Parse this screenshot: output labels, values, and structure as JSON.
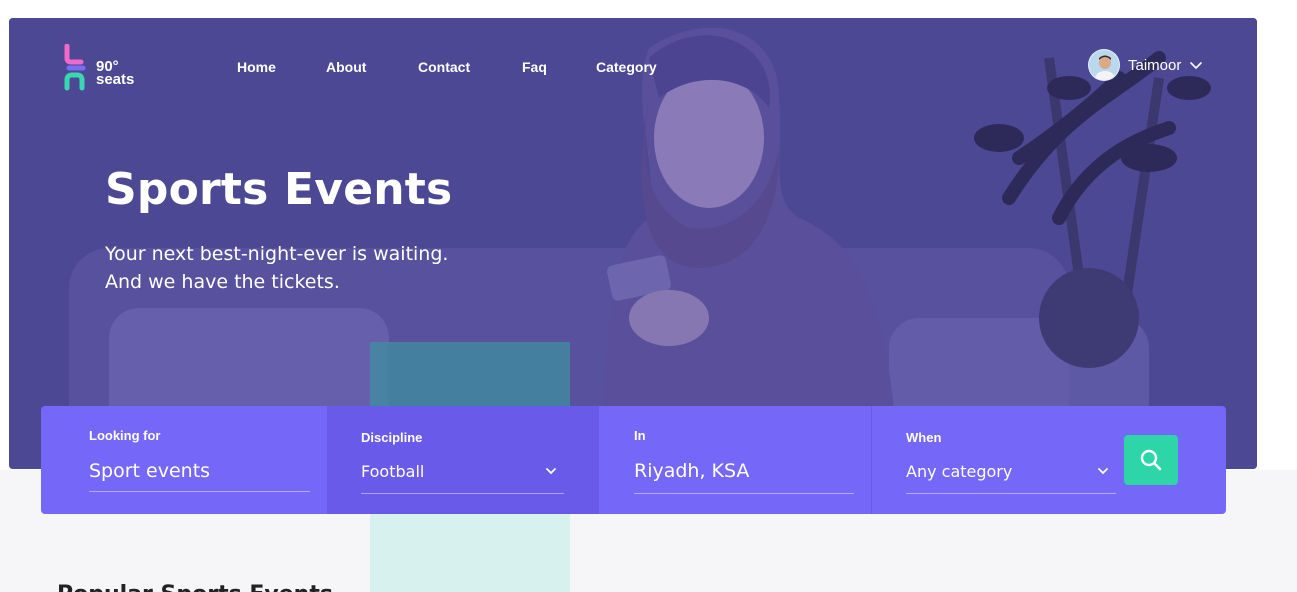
{
  "brand": {
    "logo_text_line1": "90°",
    "logo_text_line2": "seats",
    "colors": {
      "hero_overlay": "#4f4a96",
      "search_bar": "#7567f8",
      "search_button": "#2ed5a8",
      "logo_pink": "#f06ac9",
      "logo_purple": "#7b6cf6",
      "logo_teal": "#3ad6b1"
    }
  },
  "nav": {
    "items": [
      {
        "label": "Home"
      },
      {
        "label": "About"
      },
      {
        "label": "Contact"
      },
      {
        "label": "Faq"
      },
      {
        "label": "Category"
      }
    ]
  },
  "user": {
    "name": "Taimoor",
    "avatar_icon": "user-avatar",
    "menu_icon": "chevron-down-icon"
  },
  "hero": {
    "title": "Sports Events",
    "subtitle_line1": "Your next best-night-ever is waiting.",
    "subtitle_line2": "And we have the tickets."
  },
  "search": {
    "looking_for": {
      "label": "Looking for",
      "value": "Sport events"
    },
    "discipline": {
      "label": "Discipline",
      "value": "Football"
    },
    "location": {
      "label": "In",
      "value": "Riyadh, KSA"
    },
    "when": {
      "label": "When",
      "value": "Any category"
    },
    "button_icon": "search-icon"
  },
  "section": {
    "popular_title": "Popular Sports Events"
  }
}
